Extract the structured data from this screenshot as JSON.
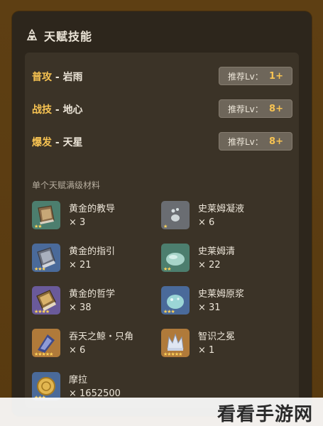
{
  "header": {
    "title": "天赋技能",
    "icon": "talent-icon"
  },
  "talents": [
    {
      "type": "普攻",
      "sep": " - ",
      "name": "岩雨",
      "rec_label": "推荐Lv：",
      "rec_value": "1+"
    },
    {
      "type": "战技",
      "sep": " - ",
      "name": "地心",
      "rec_label": "推荐Lv：",
      "rec_value": "8+"
    },
    {
      "type": "爆发",
      "sep": " - ",
      "name": "天星",
      "rec_label": "推荐Lv：",
      "rec_value": "8+"
    }
  ],
  "materials_label": "单个天赋满级材料",
  "materials": [
    {
      "name": "黄金的教导",
      "qty": "× 3",
      "icon": "book-teaching-icon",
      "rarity": 2,
      "bg": "#4c7e6e"
    },
    {
      "name": "史莱姆凝液",
      "qty": "× 6",
      "icon": "slime-condensate-icon",
      "rarity": 1,
      "bg": "#6a6d72"
    },
    {
      "name": "黄金的指引",
      "qty": "× 21",
      "icon": "book-guide-icon",
      "rarity": 3,
      "bg": "#4a6a9a"
    },
    {
      "name": "史莱姆清",
      "qty": "× 22",
      "icon": "slime-secretions-icon",
      "rarity": 2,
      "bg": "#4c7e6e"
    },
    {
      "name": "黄金的哲学",
      "qty": "× 38",
      "icon": "book-philosophy-icon",
      "rarity": 4,
      "bg": "#6a5a9a"
    },
    {
      "name": "史莱姆原浆",
      "qty": "× 31",
      "icon": "slime-concentrate-icon",
      "rarity": 3,
      "bg": "#4a6a9a"
    },
    {
      "name": "吞天之鲸・只角",
      "qty": "× 6",
      "icon": "whale-horn-icon",
      "rarity": 5,
      "bg": "#b07a3a"
    },
    {
      "name": "智识之冕",
      "qty": "× 1",
      "icon": "crown-icon",
      "rarity": 5,
      "bg": "#b07a3a"
    },
    {
      "name": "摩拉",
      "qty": "× 1652500",
      "icon": "mora-icon",
      "rarity": 3,
      "bg": "#4a6a9a"
    }
  ],
  "watermark": "看看手游网"
}
